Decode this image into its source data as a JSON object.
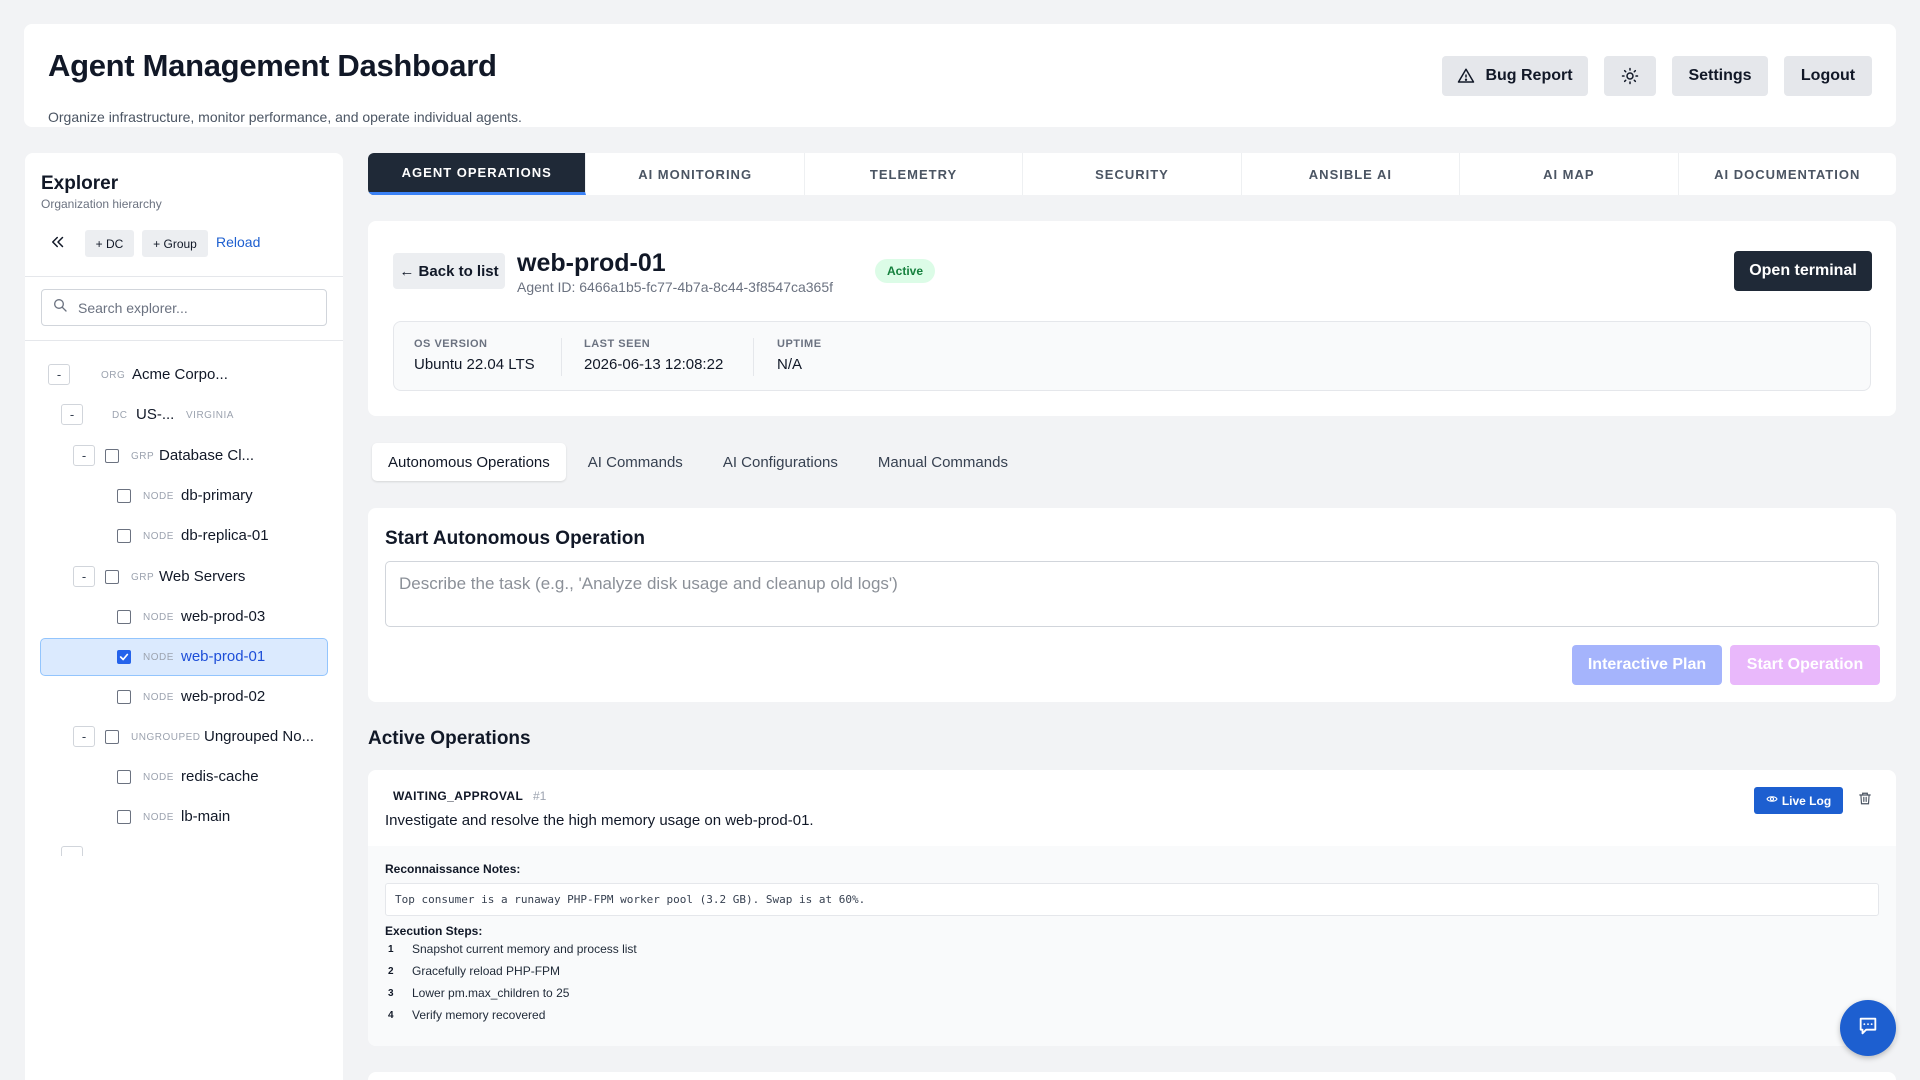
{
  "header": {
    "title": "Agent Management Dashboard",
    "subtitle": "Organize infrastructure, monitor performance, and operate individual agents.",
    "bug_report": "Bug Report",
    "settings": "Settings",
    "logout": "Logout"
  },
  "sidebar": {
    "title": "Explorer",
    "subtitle": "Organization hierarchy",
    "add_dc": "+ DC",
    "add_group": "+ Group",
    "reload": "Reload",
    "search_placeholder": "Search explorer...",
    "tree": [
      {
        "toggle": "-",
        "type": "ORG",
        "name": "Acme Corpo..."
      },
      {
        "toggle": "-",
        "type": "DC",
        "name": "US-...",
        "sub": "VIRGINIA"
      },
      {
        "toggle": "-",
        "type": "GRP",
        "name": "Database Cl..."
      },
      {
        "type": "NODE",
        "name": "db-primary"
      },
      {
        "type": "NODE",
        "name": "db-replica-01"
      },
      {
        "toggle": "-",
        "type": "GRP",
        "name": "Web Servers"
      },
      {
        "type": "NODE",
        "name": "web-prod-03"
      },
      {
        "type": "NODE",
        "name": "web-prod-01",
        "selected": true
      },
      {
        "type": "NODE",
        "name": "web-prod-02"
      },
      {
        "toggle": "-",
        "type": "UNGROUPED",
        "name": "Ungrouped No..."
      },
      {
        "type": "NODE",
        "name": "redis-cache"
      },
      {
        "type": "NODE",
        "name": "lb-main"
      }
    ]
  },
  "tabs": [
    {
      "label": "AGENT OPERATIONS",
      "active": true
    },
    {
      "label": "AI MONITORING"
    },
    {
      "label": "TELEMETRY"
    },
    {
      "label": "SECURITY"
    },
    {
      "label": "ANSIBLE AI"
    },
    {
      "label": "AI MAP"
    },
    {
      "label": "AI DOCUMENTATION"
    }
  ],
  "agent": {
    "back": "← Back to list",
    "name": "web-prod-01",
    "id": "Agent ID: 6466a1b5-fc77-4b7a-8c44-3f8547ca365f",
    "status": "Active",
    "open_terminal": "Open terminal",
    "stats": [
      {
        "label": "OS VERSION",
        "value": "Ubuntu 22.04 LTS"
      },
      {
        "label": "LAST SEEN",
        "value": "2026-06-13 12:08:22"
      },
      {
        "label": "UPTIME",
        "value": "N/A"
      }
    ]
  },
  "subtabs": [
    "Autonomous Operations",
    "AI Commands",
    "AI Configurations",
    "Manual Commands"
  ],
  "start": {
    "title": "Start Autonomous Operation",
    "placeholder": "Describe the task (e.g., 'Analyze disk usage and cleanup old logs')",
    "interactive_plan": "Interactive Plan",
    "start_operation": "Start Operation"
  },
  "active": {
    "title": "Active Operations",
    "operations": [
      {
        "status": "WAITING_APPROVAL",
        "number": "#1",
        "description": "Investigate and resolve the high memory usage on web-prod-01.",
        "live_log": "Live Log",
        "notes_label": "Reconnaissance Notes:",
        "notes": "Top consumer is a runaway PHP-FPM worker pool (3.2 GB). Swap is at 60%.",
        "steps_label": "Execution Steps:",
        "steps": [
          {
            "n": "1",
            "text": "Snapshot current memory and process list"
          },
          {
            "n": "2",
            "text": "Gracefully reload PHP-FPM"
          },
          {
            "n": "3",
            "text": "Lower pm.max_children to 25"
          },
          {
            "n": "4",
            "text": "Verify memory recovered"
          }
        ]
      }
    ]
  }
}
